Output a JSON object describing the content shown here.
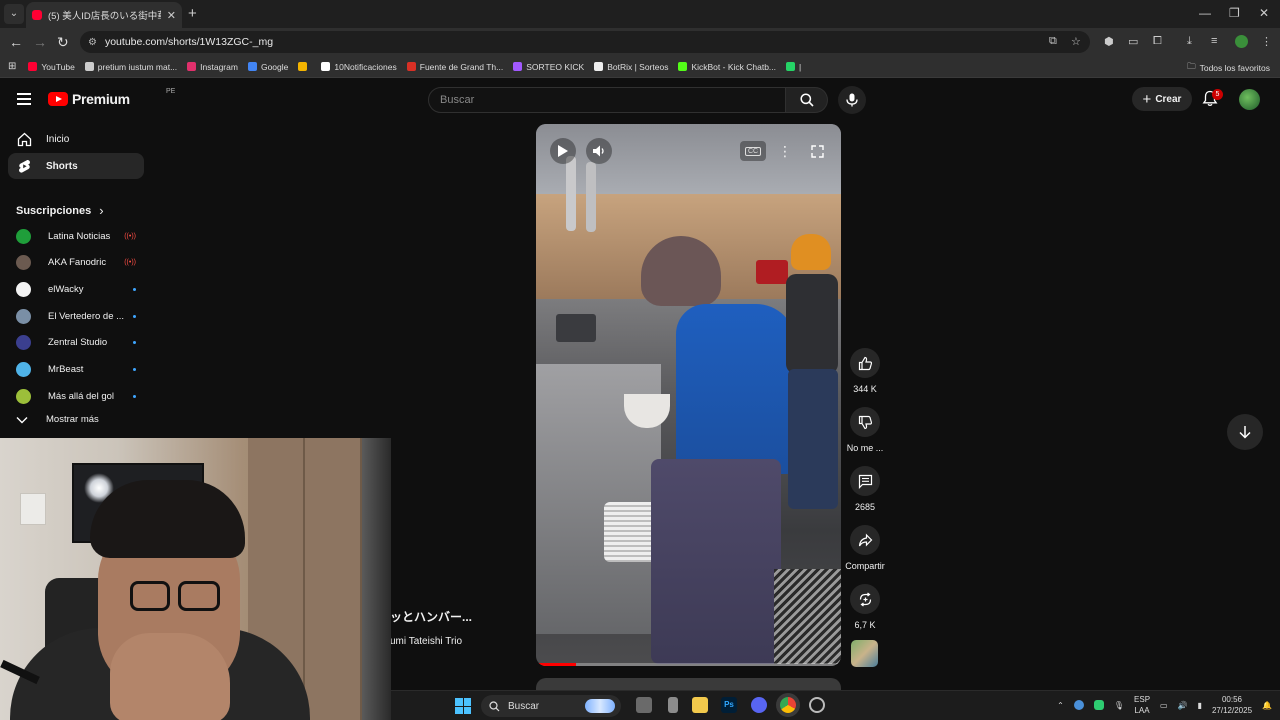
{
  "browser": {
    "tab_title": "(5) 美人ID店長のいる街中華！5",
    "url": "youtube.com/shorts/1W13ZGC-_mg",
    "bookmarks": [
      {
        "label": "YouTube",
        "color": "#ff0033"
      },
      {
        "label": "pretium iustum mat...",
        "color": "#cccccc"
      },
      {
        "label": "Instagram",
        "color": "#e1306c"
      },
      {
        "label": "Google",
        "color": "#4285f4"
      },
      {
        "label": "",
        "color": "#f4b400"
      },
      {
        "label": "10Notificaciones",
        "color": "#ffffff"
      },
      {
        "label": "Fuente de Grand Th...",
        "color": "#d93025"
      },
      {
        "label": "SORTEO KICK",
        "color": "#a259ff"
      },
      {
        "label": "BotRix | Sorteos",
        "color": "#eeeeee"
      },
      {
        "label": "KickBot - Kick Chatb...",
        "color": "#53fc18"
      },
      {
        "label": "|",
        "color": "#25d366"
      }
    ],
    "all_bookmarks_label": "Todos los favoritos"
  },
  "header": {
    "logo_text": "Premium",
    "country_code": "PE",
    "search_placeholder": "Buscar",
    "create_label": "Crear",
    "notification_count": "5"
  },
  "sidebar": {
    "items": [
      {
        "label": "Inicio",
        "icon": "home-icon"
      },
      {
        "label": "Shorts",
        "icon": "shorts-icon"
      }
    ],
    "subscriptions_title": "Suscripciones",
    "subscriptions": [
      {
        "name": "Latina Noticias",
        "live": true,
        "color": "#1f9e3a"
      },
      {
        "name": "AKA Fanodric",
        "live": true,
        "color": "#6b5a50"
      },
      {
        "name": "elWacky",
        "live": false,
        "color": "#f2f2f2"
      },
      {
        "name": "El Vertedero de ...",
        "live": false,
        "color": "#7a8fa6"
      },
      {
        "name": "Zentral Studio",
        "live": false,
        "color": "#3b3f8f"
      },
      {
        "name": "MrBeast",
        "live": false,
        "color": "#4fb3e8"
      },
      {
        "name": "Más allá del gol",
        "live": false,
        "color": "#9cbf3a"
      }
    ],
    "show_more": "Mostrar más"
  },
  "short": {
    "title": "ッとハンバー...",
    "channel": "umi Tateishi Trio",
    "progress": 0.13,
    "actions": {
      "likes": "344 K",
      "dislike": "No me ...",
      "comments": "2685",
      "share": "Compartir",
      "remix": "6,7 K"
    }
  },
  "taskbar": {
    "search_label": "Buscar",
    "language": "ESP",
    "layout": "LAA",
    "time": "00:56",
    "date": "27/12/2025"
  }
}
